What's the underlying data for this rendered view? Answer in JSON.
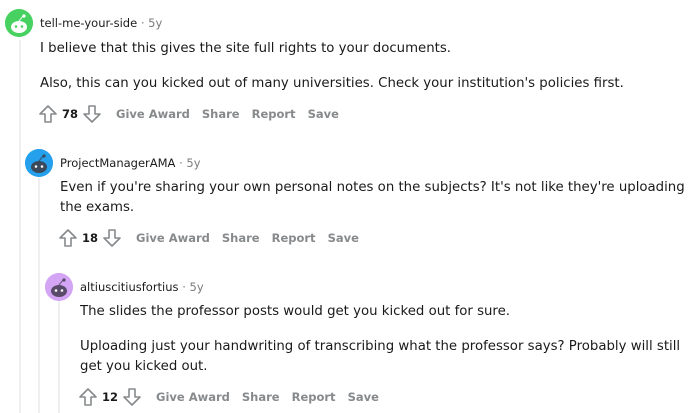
{
  "comments": [
    {
      "author": "tell-me-your-side",
      "separator": "·",
      "age": "5y",
      "avatar_color": "#46d160",
      "paragraphs": [
        "I believe that this gives the site full rights to your documents.",
        "Also, this can you kicked out of many universities. Check your institution's policies first."
      ],
      "score": "78",
      "actions": [
        "Give Award",
        "Share",
        "Report",
        "Save"
      ]
    },
    {
      "author": "ProjectManagerAMA",
      "separator": "·",
      "age": "5y",
      "avatar_color": "#24a0ed",
      "paragraphs": [
        "Even if you're sharing your own personal notes on the subjects? It's not like they're uploading the exams."
      ],
      "score": "18",
      "actions": [
        "Give Award",
        "Share",
        "Report",
        "Save"
      ]
    },
    {
      "author": "altiuscitiusfortius",
      "separator": "·",
      "age": "5y",
      "avatar_color": "#d4a5f5",
      "paragraphs": [
        "The slides the professor posts would get you kicked out for sure.",
        "Uploading just your handwriting of transcribing what the professor says? Probably will still get you kicked out."
      ],
      "score": "12",
      "actions": [
        "Give Award",
        "Share",
        "Report",
        "Save"
      ]
    }
  ]
}
